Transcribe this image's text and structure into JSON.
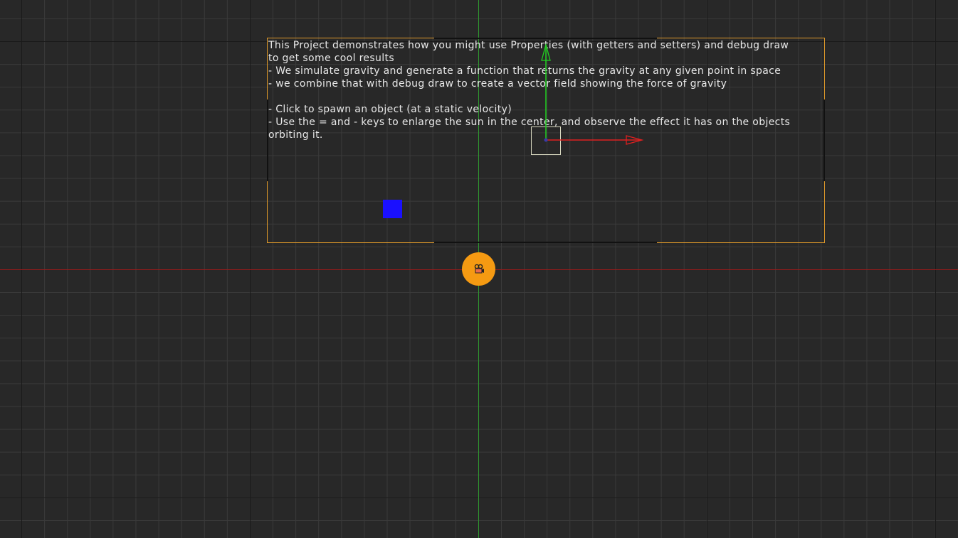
{
  "info_text": "This Project demonstrates how you might use Properties (with getters and setters) and debug draw\nto get some cool results\n- We simulate gravity and generate a function that returns the gravity at any given point in space\n- we combine that with debug draw to create a vector field showing the force of gravity\n\n- Click to spawn an object (at a static velocity)\n- Use the = and - keys to enlarge the sun in the center, and observe the effect it has on the objects\norbiting it.",
  "colors": {
    "background": "#282828",
    "grid_minor": "#3a3a3a",
    "grid_major": "#1a1a1a",
    "x_axis": "#9a1a1a",
    "y_axis": "#2f9a2f",
    "frame": "#e09a2a",
    "object": "#1a10ff",
    "camera_node": "#f59a12",
    "gizmo_x": "#e02020",
    "gizmo_y": "#20d020"
  },
  "icons": {
    "camera": "camera-icon",
    "move_gizmo": "move-gizmo-icon"
  }
}
